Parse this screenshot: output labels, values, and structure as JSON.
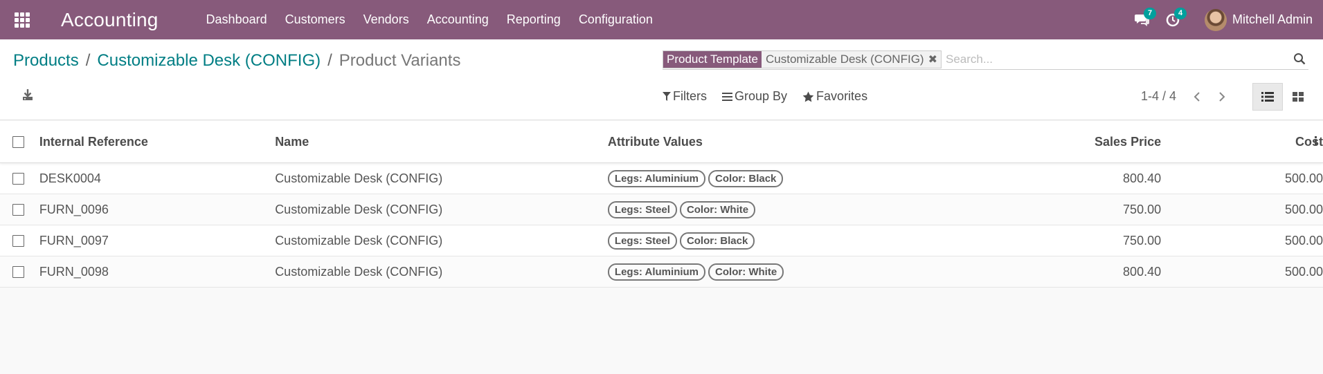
{
  "navbar": {
    "app_name": "Accounting",
    "menu": [
      "Dashboard",
      "Customers",
      "Vendors",
      "Accounting",
      "Reporting",
      "Configuration"
    ],
    "messages_count": "7",
    "activities_count": "4",
    "user_name": "Mitchell Admin",
    "bg_color": "#875a7b"
  },
  "breadcrumb": {
    "items": [
      "Products",
      "Customizable Desk (CONFIG)"
    ],
    "current": "Product Variants"
  },
  "search": {
    "facet_title": "Product Template",
    "facet_value": "Customizable Desk (CONFIG)",
    "placeholder": "Search...",
    "value": ""
  },
  "filters": {
    "filters_label": "Filters",
    "group_by_label": "Group By",
    "favorites_label": "Favorites"
  },
  "pager": {
    "value": "1-4 / 4"
  },
  "table": {
    "columns": [
      "Internal Reference",
      "Name",
      "Attribute Values",
      "Sales Price",
      "Cost"
    ],
    "rows": [
      {
        "ref": "DESK0004",
        "name": "Customizable Desk (CONFIG)",
        "attrs": [
          "Legs: Aluminium",
          "Color: Black"
        ],
        "price": "800.40",
        "cost": "500.00"
      },
      {
        "ref": "FURN_0096",
        "name": "Customizable Desk (CONFIG)",
        "attrs": [
          "Legs: Steel",
          "Color: White"
        ],
        "price": "750.00",
        "cost": "500.00"
      },
      {
        "ref": "FURN_0097",
        "name": "Customizable Desk (CONFIG)",
        "attrs": [
          "Legs: Steel",
          "Color: Black"
        ],
        "price": "750.00",
        "cost": "500.00"
      },
      {
        "ref": "FURN_0098",
        "name": "Customizable Desk (CONFIG)",
        "attrs": [
          "Legs: Aluminium",
          "Color: White"
        ],
        "price": "800.40",
        "cost": "500.00"
      }
    ]
  },
  "colors": {
    "accent": "#017e84",
    "badge": "#00a09d",
    "brand": "#875a7b"
  }
}
